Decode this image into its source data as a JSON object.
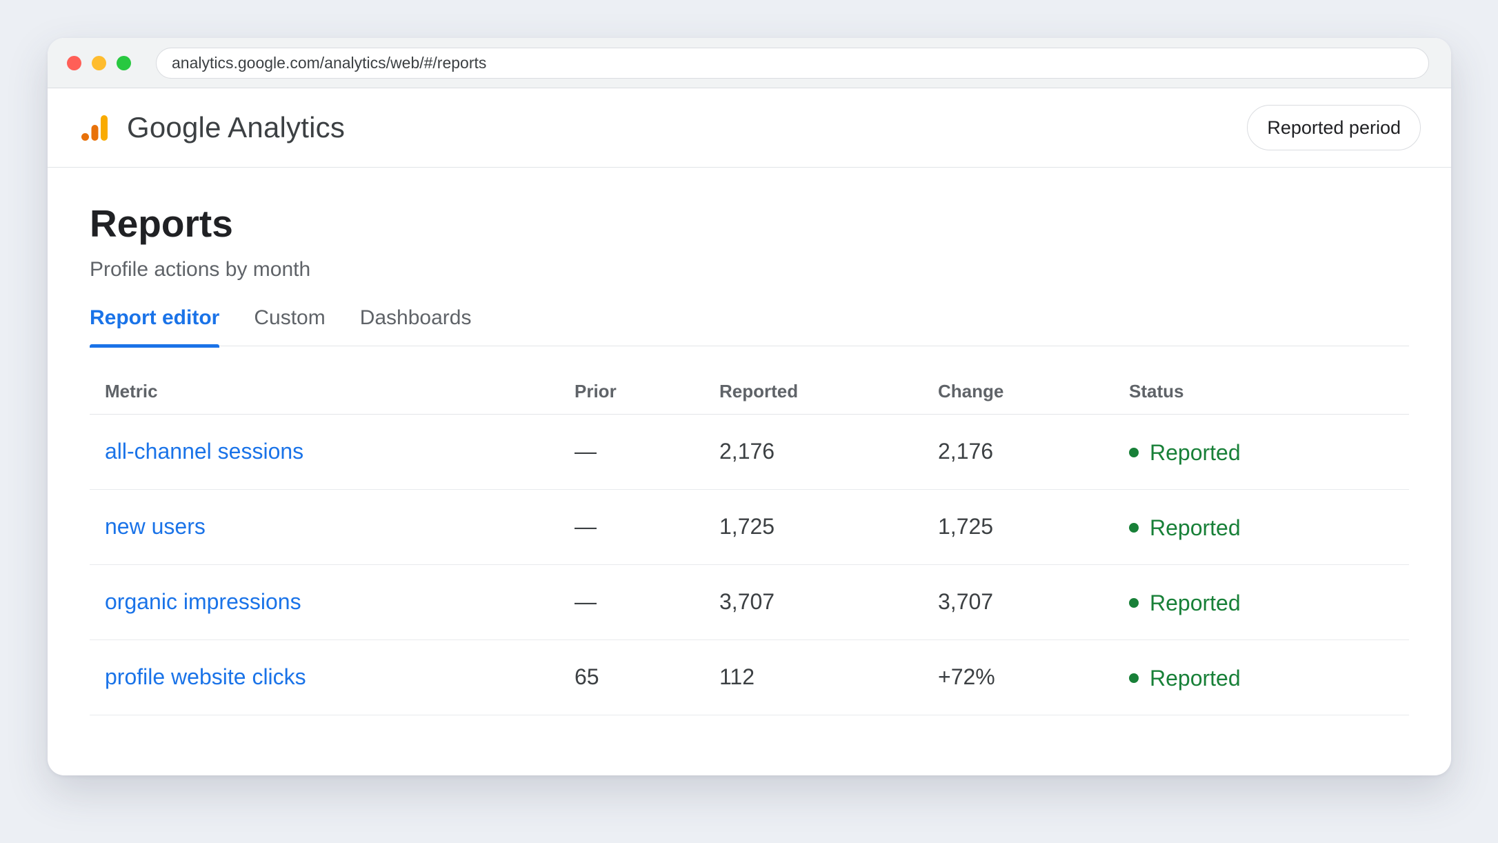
{
  "browser": {
    "url": "analytics.google.com/analytics/web/#/reports"
  },
  "header": {
    "app_title": "Google Analytics",
    "period_button": "Reported period"
  },
  "page": {
    "title": "Reports",
    "subtitle": "Profile actions by month"
  },
  "tabs": [
    {
      "label": "Report editor",
      "active": true
    },
    {
      "label": "Custom",
      "active": false
    },
    {
      "label": "Dashboards",
      "active": false
    }
  ],
  "table": {
    "columns": [
      "Metric",
      "Prior",
      "Reported",
      "Change",
      "Status"
    ],
    "rows": [
      {
        "metric": "all-channel sessions",
        "prior": "—",
        "reported": "2,176",
        "change": "2,176",
        "status": "Reported"
      },
      {
        "metric": "new users",
        "prior": "—",
        "reported": "1,725",
        "change": "1,725",
        "status": "Reported"
      },
      {
        "metric": "organic impressions",
        "prior": "—",
        "reported": "3,707",
        "change": "3,707",
        "status": "Reported"
      },
      {
        "metric": "profile website clicks",
        "prior": "65",
        "reported": "112",
        "change": "+72%",
        "status": "Reported"
      }
    ]
  },
  "colors": {
    "accent": "#1a73e8",
    "status_ok": "#188038",
    "logo_orange": "#e8710a",
    "logo_yellow": "#f9ab00"
  }
}
